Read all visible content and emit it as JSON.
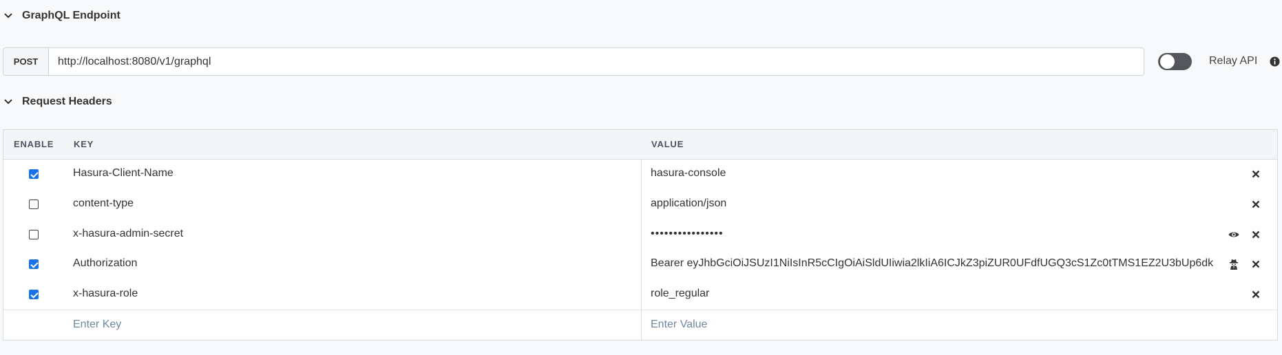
{
  "endpoint_section": {
    "title": "GraphQL Endpoint"
  },
  "endpoint": {
    "method": "POST",
    "url": "http://localhost:8080/v1/graphql",
    "relay_label": "Relay API",
    "relay_enabled": false
  },
  "headers_section": {
    "title": "Request Headers"
  },
  "headers_table": {
    "columns": {
      "enable": "ENABLE",
      "key": "KEY",
      "value": "VALUE"
    },
    "rows": [
      {
        "enabled": true,
        "key": "Hasura-Client-Name",
        "value": "hasura-console"
      },
      {
        "enabled": false,
        "key": "content-type",
        "value": "application/json"
      },
      {
        "enabled": false,
        "key": "x-hasura-admin-secret",
        "value": "••••••••••••••••",
        "aux_icon": "eye-icon"
      },
      {
        "enabled": true,
        "key": "Authorization",
        "value": "Bearer eyJhbGciOiJSUzI1NiIsInR5cCIgOiAiSldUIiwia2lkIiA6ICJkZ3piZUR0UFdfUGQ3cS1Zc0tTMS1EZ2U3bUp6dk",
        "aux_icon": "spy-icon"
      },
      {
        "enabled": true,
        "key": "x-hasura-role",
        "value": "role_regular"
      }
    ],
    "new_row": {
      "key_placeholder": "Enter Key",
      "value_placeholder": "Enter Value"
    }
  },
  "colors": {
    "accent": "#1a73e8",
    "toggle_off": "#53565a",
    "placeholder": "#6f87a0"
  }
}
